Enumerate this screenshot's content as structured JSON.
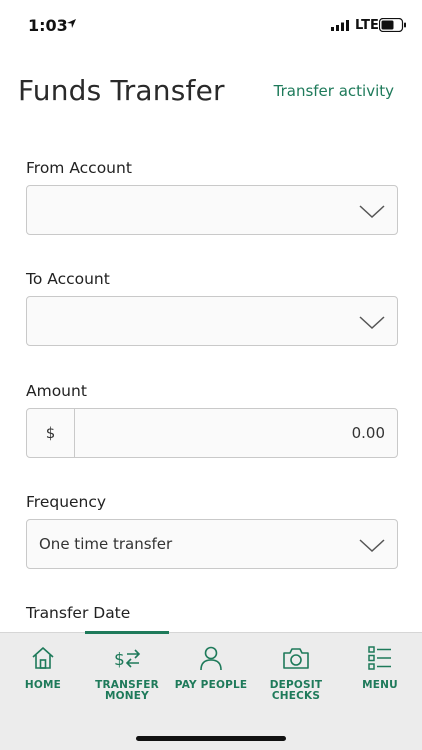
{
  "status": {
    "time": "1:03",
    "network": "LTE"
  },
  "header": {
    "title": "Funds Transfer",
    "activity_link": "Transfer activity"
  },
  "form": {
    "from_account": {
      "label": "From Account",
      "value": ""
    },
    "to_account": {
      "label": "To Account",
      "value": ""
    },
    "amount": {
      "label": "Amount",
      "prefix": "$",
      "value": "0.00"
    },
    "frequency": {
      "label": "Frequency",
      "value": "One time transfer"
    },
    "transfer_date": {
      "label": "Transfer Date"
    }
  },
  "nav": {
    "accent_color": "#1e7a5a",
    "items": [
      {
        "label": "HOME",
        "icon": "home-icon"
      },
      {
        "label": "TRANSFER\nMONEY",
        "icon": "transfer-icon",
        "active": true
      },
      {
        "label": "PAY PEOPLE",
        "icon": "person-icon"
      },
      {
        "label": "DEPOSIT\nCHECKS",
        "icon": "camera-icon"
      },
      {
        "label": "MENU",
        "icon": "menu-list-icon"
      }
    ]
  }
}
